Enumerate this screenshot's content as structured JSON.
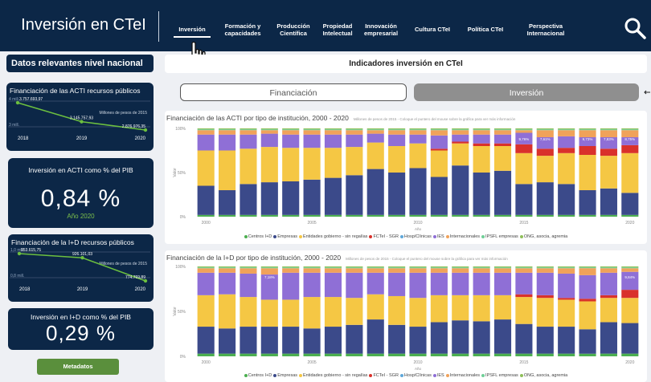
{
  "header": {
    "title": "Inversión en CTeI",
    "nav": [
      {
        "label": "Inversión",
        "active": true
      },
      {
        "label": "Formación y capacidades",
        "active": false
      },
      {
        "label": "Producción Científica",
        "active": false
      },
      {
        "label": "Propiedad Intelectual",
        "active": false
      },
      {
        "label": "Innovación empresarial",
        "active": false
      },
      {
        "label": "Cultura CTeI",
        "active": false
      },
      {
        "label": "Política CTeI",
        "active": false
      },
      {
        "label": "Perspectiva Internacional",
        "active": false
      }
    ],
    "search_icon": "search-icon"
  },
  "sidebar": {
    "heading": "Datos relevantes nivel nacional",
    "acti_card": {
      "title": "Financiación de las ACTI recursos públicos",
      "unit": "Millones de pesos de 2015",
      "ylabels": [
        "4 mill.",
        "3 mill."
      ],
      "x": [
        "2018",
        "2019",
        "2020"
      ],
      "values": [
        3757693.97,
        3145757.93,
        2876976.35
      ],
      "value_labels": [
        "3.757.693,97",
        "3.145.757,93",
        "2.876.976,35"
      ]
    },
    "acti_pib": {
      "title": "Inversión en ACTI como % del PIB",
      "value": "0,84 %",
      "sub": "Año 2020"
    },
    "id_card": {
      "title": "Financiación de la I+D recursos públicos",
      "unit": "Millones de pesos de 2015",
      "ylabels": [
        "1,0 mill.",
        "0,8 mill."
      ],
      "x": [
        "2018",
        "2019",
        "2020"
      ],
      "values": [
        953615.75,
        926101.03,
        774769.89
      ],
      "value_labels": [
        "953.615,75",
        "926.101,03",
        "774.769,89"
      ]
    },
    "id_pib": {
      "title": "Inversión en I+D como % del PIB",
      "value": "0,29 %"
    },
    "metadata_button": "Metadatos"
  },
  "main": {
    "heading": "Indicadores inversión en CTeI",
    "tabs": [
      {
        "label": "Financiación",
        "active": false
      },
      {
        "label": "Inversión",
        "active": true
      }
    ]
  },
  "colors": {
    "navy": "#0c2747",
    "accent_green": "#7cc04b",
    "centros": "#4caf50",
    "empresas": "#3b4a8a",
    "entidades": "#f5c744",
    "fctel": "#d9312b",
    "hosp": "#5fa8d9",
    "ies": "#8f6fd6",
    "internacionales": "#f0a25a",
    "ipsfl": "#6fcf97",
    "ong": "#8fbf5a"
  },
  "chart_data": [
    {
      "type": "bar",
      "stacked": true,
      "title": "Financiación de las ACTI por tipo de institución, 2000 - 2020",
      "note": "Millones de pesos de 2015 - Coloque el puntero del mouse sobre la gráfica para ver más información",
      "xlabel": "Año",
      "ylabel": "Valor",
      "ylim": [
        0,
        100
      ],
      "yticks": [
        "0%",
        "50%",
        "100%"
      ],
      "xticks": [
        "2000",
        "2005",
        "2010",
        "2015",
        "2020"
      ],
      "categories": [
        "2000",
        "2001",
        "2002",
        "2003",
        "2004",
        "2005",
        "2006",
        "2007",
        "2008",
        "2009",
        "2010",
        "2011",
        "2012",
        "2013",
        "2014",
        "2015",
        "2016",
        "2017",
        "2018",
        "2019",
        "2020"
      ],
      "annotations": {
        "15": "9,76%",
        "16": "7,61%",
        "18": "9,73%",
        "19": "7,83%",
        "20": "8,75%"
      },
      "series": [
        {
          "name": "Centros I+D",
          "key": "centros",
          "values": [
            2,
            2,
            2,
            2,
            2,
            2,
            2,
            2,
            2,
            2,
            2,
            2,
            2,
            2,
            2,
            2,
            2,
            2,
            2,
            2,
            2
          ]
        },
        {
          "name": "Empresas",
          "key": "empresas",
          "values": [
            33,
            28,
            35,
            37,
            38,
            40,
            42,
            45,
            52,
            48,
            53,
            43,
            56,
            48,
            50,
            35,
            37,
            35,
            28,
            30,
            25
          ]
        },
        {
          "name": "Entidades gobierno - sin regalías",
          "key": "entidades",
          "values": [
            40,
            45,
            40,
            40,
            38,
            36,
            34,
            32,
            30,
            30,
            28,
            30,
            25,
            30,
            28,
            35,
            30,
            35,
            40,
            37,
            45
          ]
        },
        {
          "name": "FCTeI - SGR",
          "key": "fctel",
          "values": [
            0,
            0,
            0,
            0,
            0,
            0,
            0,
            0,
            0,
            0,
            0,
            2,
            2,
            3,
            3,
            10,
            8,
            6,
            10,
            8,
            9
          ]
        },
        {
          "name": "Hosp/Clínicas",
          "key": "hosp",
          "values": [
            0,
            0,
            0,
            0,
            0,
            0,
            0,
            0,
            0,
            0,
            0,
            0,
            0,
            0,
            0,
            0,
            0,
            0,
            0,
            0,
            0
          ]
        },
        {
          "name": "IES",
          "key": "ies",
          "values": [
            18,
            18,
            16,
            15,
            15,
            15,
            15,
            14,
            10,
            13,
            10,
            15,
            8,
            10,
            10,
            13,
            13,
            13,
            10,
            13,
            9
          ]
        },
        {
          "name": "Internacionales",
          "key": "internacionales",
          "values": [
            5,
            5,
            5,
            4,
            5,
            5,
            5,
            5,
            4,
            5,
            5,
            6,
            5,
            5,
            5,
            3,
            8,
            7,
            8,
            8,
            8
          ]
        },
        {
          "name": "IPSFL empresas",
          "key": "ipsfl",
          "values": [
            1,
            1,
            1,
            1,
            1,
            1,
            1,
            1,
            1,
            1,
            1,
            1,
            1,
            1,
            1,
            1,
            1,
            1,
            1,
            1,
            1
          ]
        },
        {
          "name": "ONG, asocia, agremia",
          "key": "ong",
          "values": [
            1,
            1,
            1,
            1,
            1,
            1,
            1,
            1,
            1,
            1,
            1,
            1,
            1,
            1,
            1,
            1,
            1,
            1,
            1,
            1,
            1
          ]
        }
      ]
    },
    {
      "type": "bar",
      "stacked": true,
      "title": "Financiación de la I+D por tipo de institución, 2000 - 2020",
      "note": "Millones de pesos de 2015 - Coloque el puntero del mouse sobre la gráfica para ver más información",
      "xlabel": "Año",
      "ylabel": "Valor",
      "ylim": [
        0,
        100
      ],
      "yticks": [
        "0%",
        "50%",
        "100%"
      ],
      "xticks": [
        "2000",
        "2005",
        "2010",
        "2015",
        "2020"
      ],
      "categories": [
        "2000",
        "2001",
        "2002",
        "2003",
        "2004",
        "2005",
        "2006",
        "2007",
        "2008",
        "2009",
        "2010",
        "2011",
        "2012",
        "2013",
        "2014",
        "2015",
        "2016",
        "2017",
        "2018",
        "2019",
        "2020"
      ],
      "annotations": {
        "3": "7,18%",
        "20": "9,84%"
      },
      "series": [
        {
          "name": "Centros I+D",
          "key": "centros",
          "values": [
            3,
            3,
            3,
            3,
            3,
            3,
            3,
            3,
            3,
            3,
            3,
            3,
            3,
            3,
            3,
            3,
            3,
            3,
            3,
            3,
            3
          ]
        },
        {
          "name": "Empresas",
          "key": "empresas",
          "values": [
            30,
            28,
            30,
            30,
            30,
            28,
            30,
            32,
            38,
            32,
            30,
            35,
            37,
            36,
            38,
            33,
            30,
            30,
            28,
            35,
            34
          ]
        },
        {
          "name": "Entidades gobierno - sin regalías",
          "key": "entidades",
          "values": [
            35,
            38,
            33,
            30,
            30,
            35,
            33,
            30,
            28,
            32,
            32,
            30,
            28,
            29,
            27,
            30,
            32,
            30,
            32,
            27,
            28
          ]
        },
        {
          "name": "FCTeI - SGR",
          "key": "fctel",
          "values": [
            0,
            0,
            0,
            0,
            0,
            0,
            0,
            0,
            0,
            0,
            0,
            0,
            0,
            0,
            0,
            3,
            3,
            2,
            3,
            3,
            9
          ]
        },
        {
          "name": "Hosp/Clínicas",
          "key": "hosp",
          "values": [
            0,
            0,
            0,
            0,
            0,
            0,
            0,
            0,
            0,
            0,
            0,
            0,
            0,
            0,
            0,
            0,
            0,
            0,
            0,
            0,
            0
          ]
        },
        {
          "name": "IES",
          "key": "ies",
          "values": [
            25,
            24,
            26,
            28,
            30,
            27,
            27,
            28,
            24,
            26,
            28,
            25,
            25,
            25,
            25,
            24,
            25,
            27,
            27,
            25,
            20
          ]
        },
        {
          "name": "Internacionales",
          "key": "internacionales",
          "values": [
            5,
            5,
            6,
            7,
            5,
            5,
            5,
            5,
            5,
            5,
            5,
            5,
            5,
            5,
            5,
            5,
            5,
            6,
            8,
            5,
            4
          ]
        },
        {
          "name": "IPSFL empresas",
          "key": "ipsfl",
          "values": [
            1,
            1,
            1,
            1,
            1,
            1,
            1,
            1,
            1,
            1,
            1,
            1,
            1,
            1,
            1,
            1,
            1,
            1,
            1,
            1,
            1
          ]
        },
        {
          "name": "ONG, asocia, agremia",
          "key": "ong",
          "values": [
            1,
            1,
            1,
            1,
            1,
            1,
            1,
            1,
            1,
            1,
            1,
            1,
            1,
            1,
            1,
            1,
            1,
            1,
            1,
            1,
            1
          ]
        }
      ]
    }
  ]
}
